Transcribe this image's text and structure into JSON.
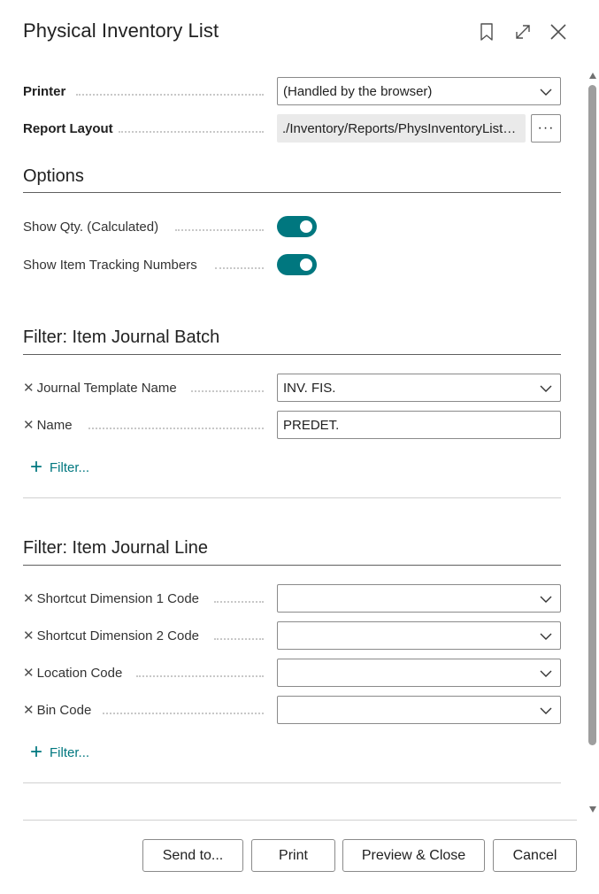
{
  "header": {
    "title": "Physical Inventory List",
    "icons": [
      "bookmark-icon",
      "expand-icon",
      "close-icon"
    ]
  },
  "printer": {
    "label": "Printer",
    "value": "(Handled by the browser)"
  },
  "report_layout": {
    "label": "Report Layout",
    "value": "./Inventory/Reports/PhysInventoryList.rdlc",
    "more_label": "···"
  },
  "options": {
    "title": "Options",
    "show_qty": {
      "label": "Show Qty. (Calculated)",
      "on": true
    },
    "show_tracking": {
      "label": "Show Item Tracking Numbers",
      "on": true
    }
  },
  "filter_batch": {
    "title": "Filter: Item Journal Batch",
    "fields": [
      {
        "label": "Journal Template Name",
        "value": "INV. FIS."
      },
      {
        "label": "Name",
        "value": "PREDET."
      }
    ],
    "add_filter_label": "Filter..."
  },
  "filter_line": {
    "title": "Filter: Item Journal Line",
    "fields": [
      {
        "label": "Shortcut Dimension 1 Code",
        "value": ""
      },
      {
        "label": "Shortcut Dimension 2 Code",
        "value": ""
      },
      {
        "label": "Location Code",
        "value": ""
      },
      {
        "label": "Bin Code",
        "value": ""
      }
    ],
    "add_filter_label": "Filter..."
  },
  "footer": {
    "send_to": "Send to...",
    "print": "Print",
    "preview_close": "Preview & Close",
    "cancel": "Cancel"
  },
  "colors": {
    "accent": "#00777f",
    "text": "#212121",
    "border": "#8a8a8a"
  }
}
